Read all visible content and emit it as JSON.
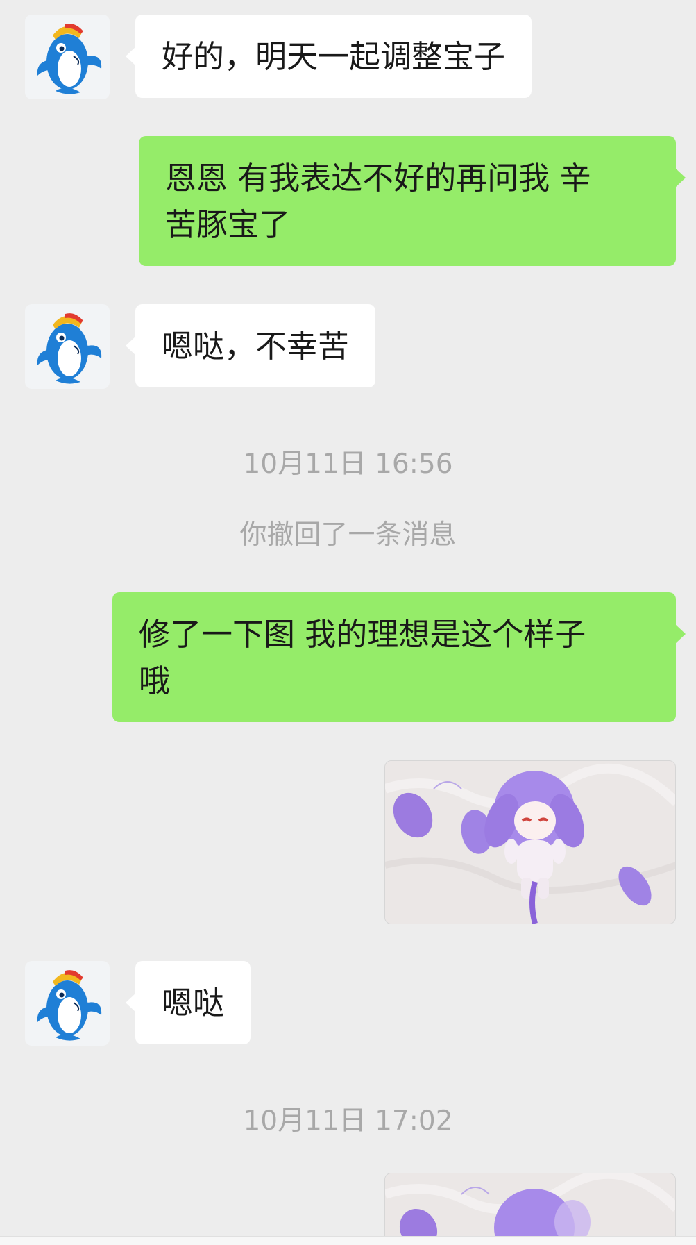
{
  "messages": [
    {
      "side": "in",
      "text": "好的，明天一起调整宝子"
    },
    {
      "side": "out",
      "text_line1": "恩恩 有我表达不好的再问我 辛",
      "text_line2": "苦豚宝了"
    },
    {
      "side": "in",
      "text": "嗯哒，不幸苦"
    },
    {
      "type": "time",
      "text": "10月11日 16:56"
    },
    {
      "type": "system",
      "text": "你撤回了一条消息"
    },
    {
      "side": "out",
      "text_line1": "修了一下图 我的理想是这个样子",
      "text_line2": "哦"
    },
    {
      "side": "out",
      "type": "image",
      "icon": "plush-doll-photo"
    },
    {
      "side": "in",
      "text": "嗯哒"
    },
    {
      "type": "time",
      "text": "10月11日 17:02"
    },
    {
      "side": "out",
      "type": "image",
      "icon": "plush-doll-photo"
    }
  ],
  "colors": {
    "background": "#ededed",
    "bubble_out": "#95ec69",
    "bubble_in": "#ffffff",
    "system_text": "#a8a8a8"
  },
  "avatar": {
    "icon": "dolphin-mascot-icon"
  }
}
